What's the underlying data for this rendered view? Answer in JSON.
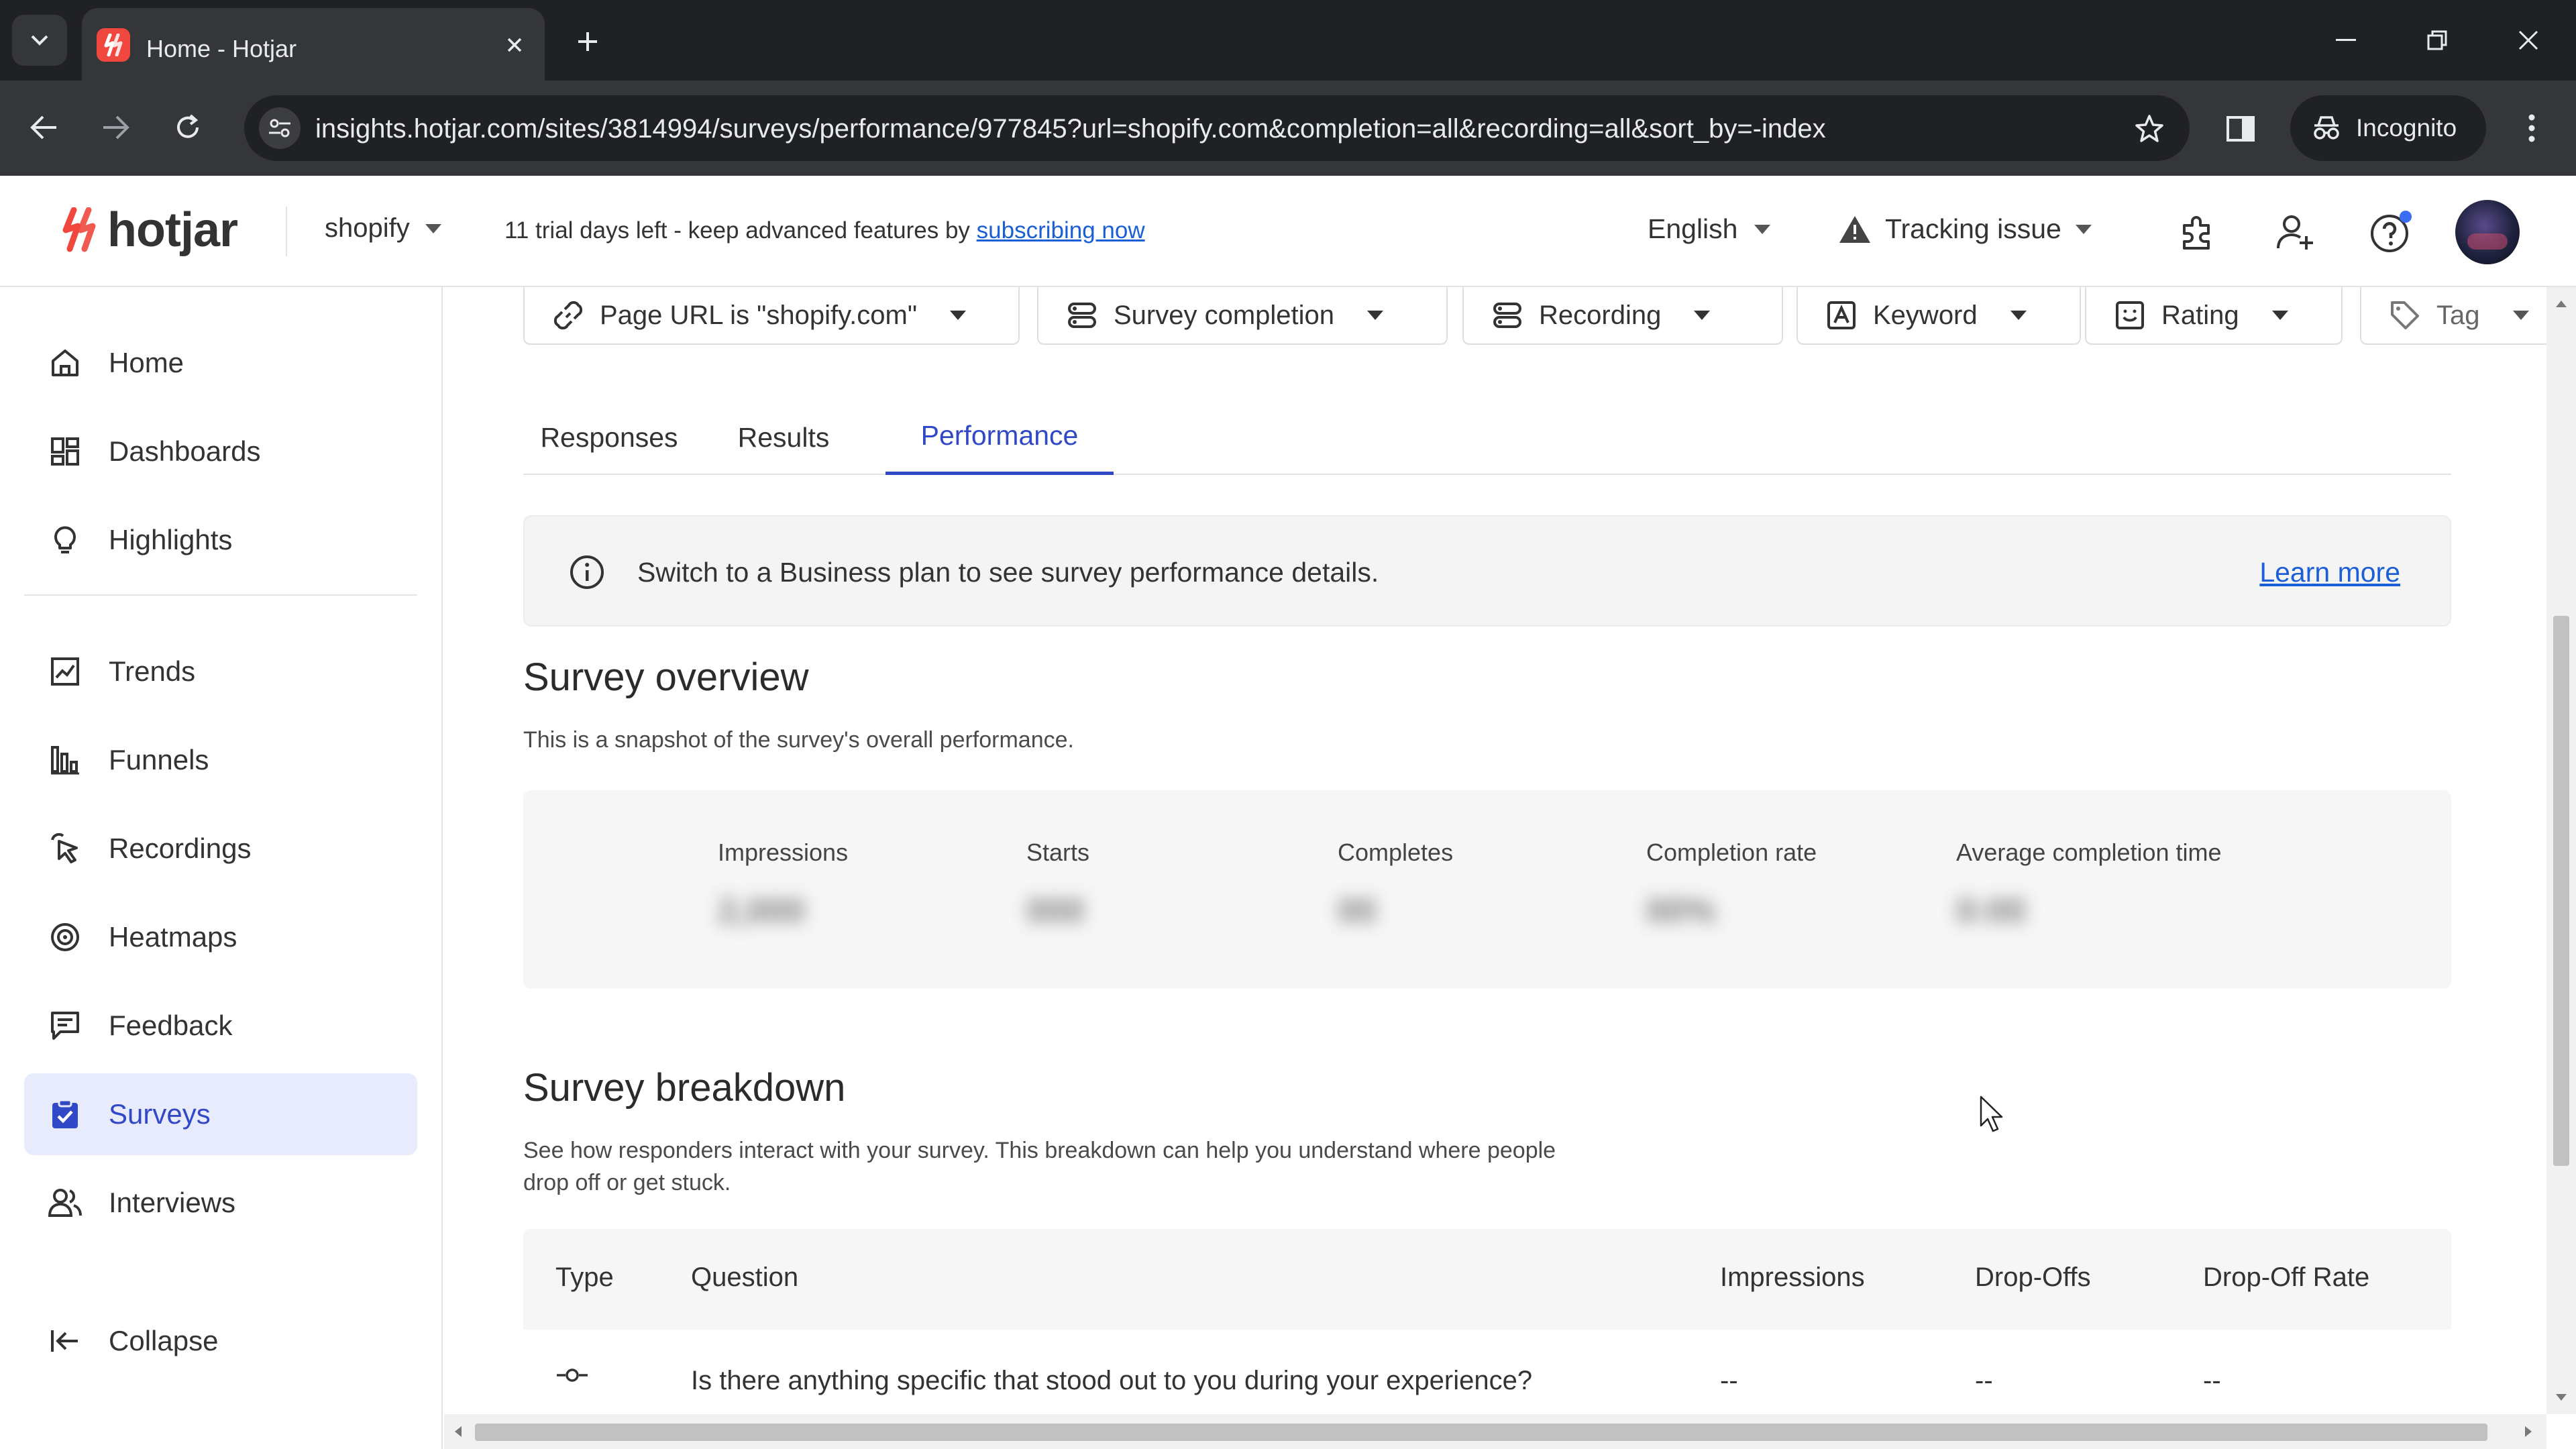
{
  "browser": {
    "tab_title": "Home - Hotjar",
    "url": "insights.hotjar.com/sites/3814994/surveys/performance/977845?url=shopify.com&completion=all&recording=all&sort_by=-index",
    "incognito_label": "Incognito"
  },
  "header": {
    "logo_text": "hotjar",
    "site": "shopify",
    "trial_text": "11 trial days left - keep advanced features by ",
    "trial_link": "subscribing now",
    "language": "English",
    "tracking": "Tracking issue"
  },
  "sidebar": {
    "items": [
      {
        "label": "Home",
        "icon": "home-icon"
      },
      {
        "label": "Dashboards",
        "icon": "dashboards-icon"
      },
      {
        "label": "Highlights",
        "icon": "lightbulb-icon"
      },
      {
        "label": "Trends",
        "icon": "trends-icon"
      },
      {
        "label": "Funnels",
        "icon": "funnels-icon"
      },
      {
        "label": "Recordings",
        "icon": "recordings-icon"
      },
      {
        "label": "Heatmaps",
        "icon": "heatmaps-icon"
      },
      {
        "label": "Feedback",
        "icon": "feedback-icon"
      },
      {
        "label": "Surveys",
        "icon": "surveys-icon",
        "active": true
      },
      {
        "label": "Interviews",
        "icon": "interviews-icon"
      }
    ],
    "collapse_label": "Collapse"
  },
  "filters": [
    {
      "label": "Page URL is \"shopify.com\"",
      "icon": "link-icon"
    },
    {
      "label": "Survey completion",
      "icon": "survey-completion-icon"
    },
    {
      "label": "Recording",
      "icon": "recording-icon"
    },
    {
      "label": "Keyword",
      "icon": "keyword-icon"
    },
    {
      "label": "Rating",
      "icon": "rating-icon"
    },
    {
      "label": "Tag",
      "icon": "tag-icon"
    }
  ],
  "tabs": [
    {
      "label": "Responses"
    },
    {
      "label": "Results"
    },
    {
      "label": "Performance",
      "active": true
    }
  ],
  "banner": {
    "message": "Switch to a Business plan to see survey performance details.",
    "link": "Learn more"
  },
  "overview": {
    "title": "Survey overview",
    "subtitle": "This is a snapshot of the survey's overall performance.",
    "metrics": [
      {
        "label": "Impressions",
        "value": "2,000"
      },
      {
        "label": "Starts",
        "value": "000"
      },
      {
        "label": "Completes",
        "value": "00"
      },
      {
        "label": "Completion rate",
        "value": "00%"
      },
      {
        "label": "Average completion time",
        "value": "0:00"
      }
    ]
  },
  "breakdown": {
    "title": "Survey breakdown",
    "subtitle_line1": "See how responders interact with your survey. This breakdown can help you understand where people",
    "subtitle_line2": "drop off or get stuck.",
    "columns": [
      "Type",
      "Question",
      "Impressions",
      "Drop-Offs",
      "Drop-Off Rate"
    ],
    "rows": [
      {
        "type_icon": "-o-",
        "question": "Is there anything specific that stood out to you during your experience?",
        "impressions": "--",
        "dropoffs": "--",
        "rate": "--"
      }
    ]
  },
  "colors": {
    "accent": "#3148c7",
    "active_bg": "#e8ebfb",
    "brand": "#f0483e",
    "link": "#1a5fd6"
  }
}
